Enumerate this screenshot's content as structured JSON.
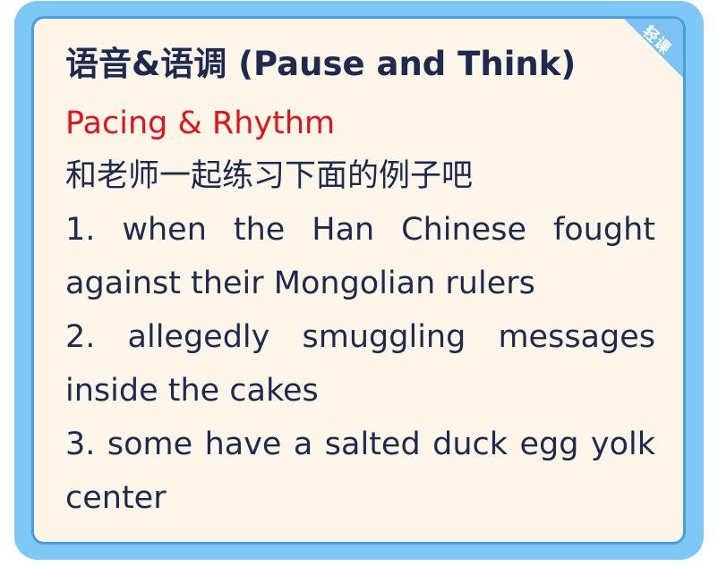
{
  "card": {
    "badge": "轻课",
    "title": "语音&语调 (Pause and Think)",
    "subtitle": "Pacing & Rhythm",
    "intro": "和老师一起练习下面的例子吧",
    "examples": [
      "1. when the Han Chinese fought against their Mongolian rulers",
      "2. allegedly smuggling messages inside the cakes",
      "3. some have a salted duck egg yolk center"
    ]
  },
  "colors": {
    "frame": "#7ec8f7",
    "card_border": "#4a9ee0",
    "card_background": "#fdf6e8",
    "title_text": "#1b2a4e",
    "subtitle_text": "#e0131a",
    "badge": "#7cc2f2"
  }
}
